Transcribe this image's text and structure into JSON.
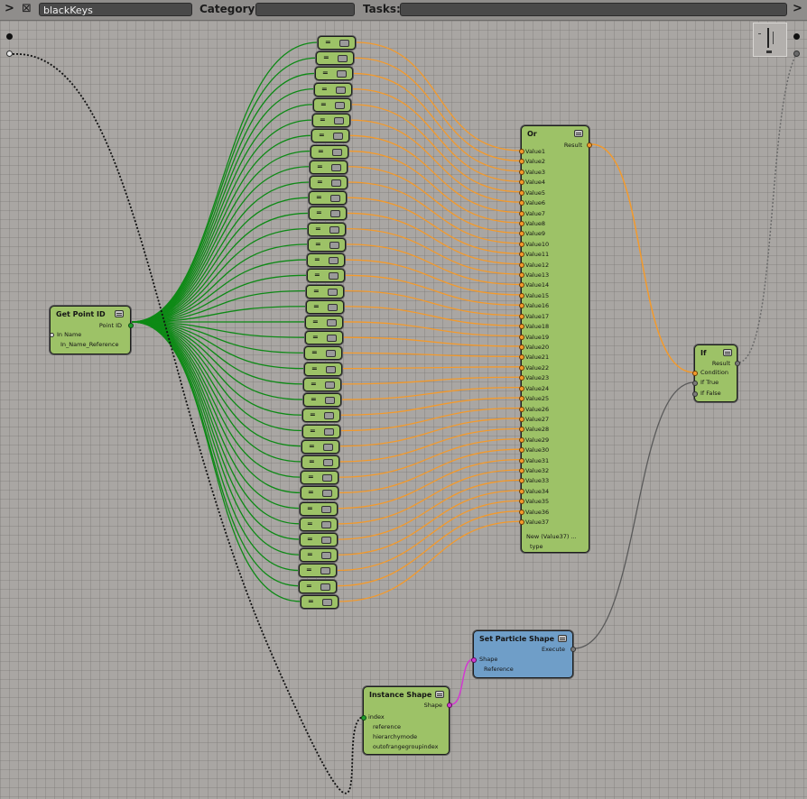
{
  "toolbar": {
    "expand_glyph": ">",
    "close_glyph": "⊠",
    "graph_name": "blackKeys",
    "category_label": "Category:",
    "category_value": "",
    "tasks_label": "Tasks:",
    "tasks_value": "",
    "right_glyph": ">"
  },
  "icons": {
    "node_menu": "node-menu-icon",
    "eq_menu": "node-menu-icon"
  },
  "colors": {
    "node_green": "#9dc267",
    "node_blue": "#6f9ec8",
    "wire_green": "#0e8a16",
    "wire_orange": "#f39a2c",
    "wire_grey": "#5a5a5a",
    "wire_magenta": "#d23ad0"
  },
  "nodes": {
    "get_point_id": {
      "title": "Get Point ID",
      "outputs": [
        "Point ID"
      ],
      "inputs": [
        "In Name",
        "In_Name_Reference"
      ]
    },
    "or": {
      "title": "Or",
      "outputs": [
        "Result"
      ],
      "inputs": [
        "Value1",
        "Value2",
        "Value3",
        "Value4",
        "Value5",
        "Value6",
        "Value7",
        "Value8",
        "Value9",
        "Value10",
        "Value11",
        "Value12",
        "Value13",
        "Value14",
        "Value15",
        "Value16",
        "Value17",
        "Value18",
        "Value19",
        "Value20",
        "Value21",
        "Value22",
        "Value23",
        "Value24",
        "Value25",
        "Value26",
        "Value27",
        "Value28",
        "Value29",
        "Value30",
        "Value31",
        "Value32",
        "Value33",
        "Value34",
        "Value35",
        "Value36",
        "Value37"
      ],
      "extra": [
        "New (Value37) ...",
        "type"
      ]
    },
    "if": {
      "title": "If",
      "outputs": [
        "Result"
      ],
      "inputs": [
        "Condition",
        "If True",
        "If False"
      ]
    },
    "set_particle_shape": {
      "title": "Set Particle Shape",
      "outputs": [
        "Execute"
      ],
      "inputs": [
        "Shape",
        "Reference"
      ]
    },
    "instance_shape": {
      "title": "Instance Shape",
      "outputs": [
        "Shape"
      ],
      "inputs": [
        "index",
        "reference",
        "hierarchymode",
        "outofrangegroupindex"
      ]
    },
    "equals": {
      "label": "=",
      "count": 37
    }
  }
}
